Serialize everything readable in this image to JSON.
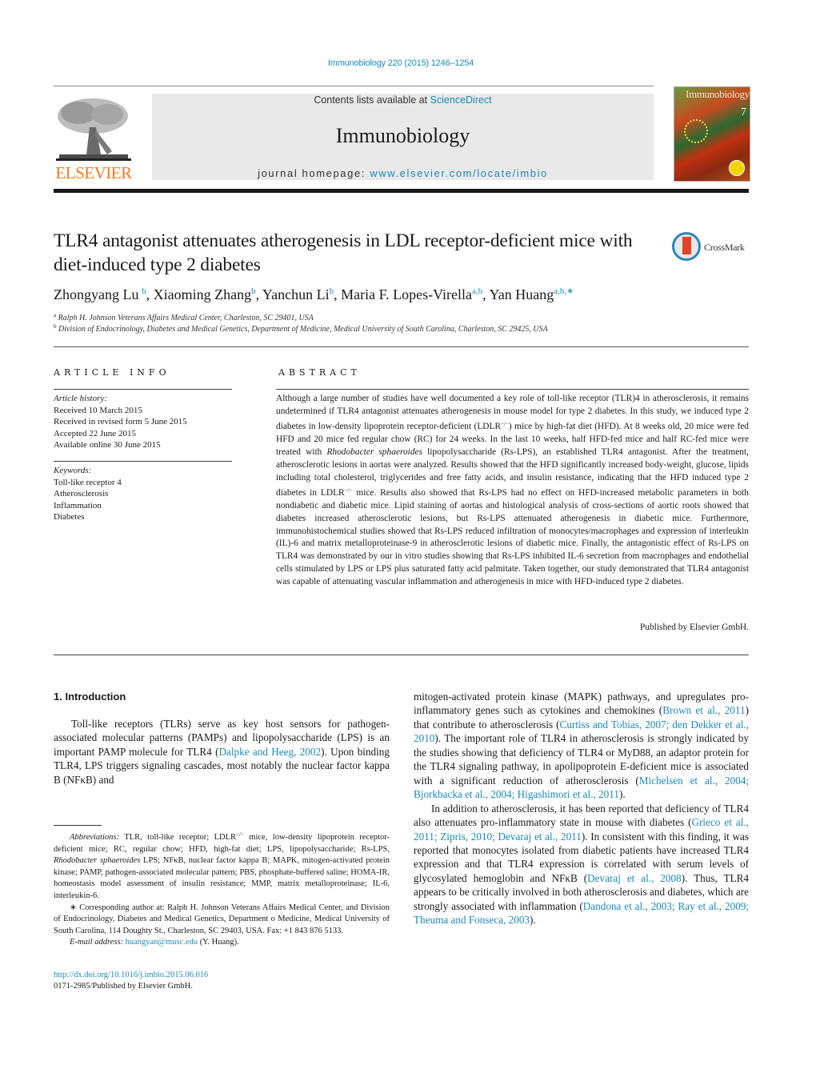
{
  "header": {
    "journal_ref": "Immunobiology 220 (2015) 1246–1254",
    "publisher_logo_text": "ELSEVIER",
    "contents_prefix": "Contents lists available at ",
    "contents_link": "ScienceDirect",
    "journal_title": "Immunobiology",
    "homepage_prefix": "journal homepage: ",
    "homepage_link": "www.elsevier.com/locate/imbio",
    "cover": {
      "title": "Immunobiology",
      "volume_number": "7"
    },
    "crossmark_label": "CrossMark"
  },
  "article": {
    "title": "TLR4 antagonist attenuates atherogenesis in LDL receptor-deficient mice with diet-induced type 2 diabetes",
    "authors": [
      {
        "name": "Zhongyang Lu",
        "sup": "b",
        "sep": ", "
      },
      {
        "name": "Xiaoming Zhang",
        "sup": "b",
        "sep": ", "
      },
      {
        "name": "Yanchun Li",
        "sup": "b",
        "sep": ", "
      },
      {
        "name": "Maria F. Lopes-Virella",
        "sup": "a,b",
        "sep": ", "
      },
      {
        "name": "Yan Huang",
        "sup": "a,b,∗",
        "sep": ""
      }
    ],
    "affiliations": [
      {
        "key": "a",
        "text": "Ralph H. Johnson Veterans Affairs Medical Center, Charleston, SC 29401, USA"
      },
      {
        "key": "b",
        "text": "Division of Endocrinology, Diabetes and Medical Genetics, Department of Medicine, Medical University of South Carolina, Charleston, SC 29425, USA"
      }
    ]
  },
  "article_info": {
    "heading": "ARTICLE INFO",
    "history_label": "Article history:",
    "history": [
      "Received 10 March 2015",
      "Received in revised form 5 June 2015",
      "Accepted 22 June 2015",
      "Available online 30 June 2015"
    ],
    "keywords_label": "Keywords:",
    "keywords": [
      "Toll-like receptor 4",
      "Atherosclerosis",
      "Inflammation",
      "Diabetes"
    ]
  },
  "abstract": {
    "heading": "ABSTRACT",
    "parts": {
      "p1": "Although a large number of studies have well documented a key role of toll-like receptor (TLR)4 in atherosclerosis, it remains undetermined if TLR4 antagonist attenuates atherogenesis in mouse model for type 2 diabetes. In this study, we induced type 2 diabetes in low-density lipoprotein receptor-deficient (LDLR",
      "ko": "−/−",
      "p2": ") mice by high-fat diet (HFD). At 8 weeks old, 20 mice were fed HFD and 20 mice fed regular chow (RC) for 24 weeks. In the last 10 weeks, half HFD-fed mice and half RC-fed mice were treated with ",
      "species": "Rhodobacter sphaeroides",
      "p3": " lipopolysaccharide (Rs-LPS), an established TLR4 antagonist. After the treatment, atherosclerotic lesions in aortas were analyzed. Results showed that the HFD significantly increased body-weight, glucose, lipids including total cholesterol, triglycerides and free fatty acids, and insulin resistance, indicating that the HFD induced type 2 diabetes in LDLR",
      "p4": " mice. Results also showed that Rs-LPS had no effect on HFD-increased metabolic parameters in both nondiabetic and diabetic mice. Lipid staining of aortas and histological analysis of cross-sections of aortic roots showed that diabetes increased atherosclerotic lesions, but Rs-LPS attenuated atherogenesis in diabetic mice. Furthermore, immunohistochemical studies showed that Rs-LPS reduced infiltration of monocytes/macrophages and expression of interleukin (IL)-6 and matrix metalloproteinase-9 in atherosclerotic lesions of diabetic mice. Finally, the antagonistic effect of Rs-LPS on TLR4 was demonstrated by our in vitro studies showing that Rs-LPS inhibited IL-6 secretion from macrophages and endothelial cells stimulated by LPS or LPS plus saturated fatty acid palmitate. Taken together, our study demonstrated that TLR4 antagonist was capable of attenuating vascular inflammation and atherogenesis in mice with HFD-induced type 2 diabetes."
    },
    "published_by": "Published by Elsevier GmbH."
  },
  "introduction": {
    "heading": "1.  Introduction",
    "left": {
      "t1": "Toll-like receptors (TLRs) serve as key host sensors for pathogen-associated molecular patterns (PAMPs) and lipopolysaccharide (LPS) is an important PAMP molecule for TLR4 (",
      "c1": "Dalpke and Heeg, 2002",
      "t2": "). Upon binding TLR4, LPS triggers signaling cascades, most notably the nuclear factor kappa B (NFκB) and"
    },
    "right_p1": {
      "t1": "mitogen-activated protein kinase (MAPK) pathways, and upregulates pro-inflammatory genes such as cytokines and chemokines (",
      "c1": "Brown et al., 2011",
      "t2": ") that contribute to atherosclerosis (",
      "c2": "Curtiss and Tobias, 2007; den Dekker et al., 2010",
      "t3": "). The important role of TLR4 in atherosclerosis is strongly indicated by the studies showing that deficiency of TLR4 or MyD88, an adaptor protein for the TLR4 signaling pathway, in apolipoprotein E-deficient mice is associated with a significant reduction of atherosclerosis (",
      "c3": "Michelsen et al., 2004; Bjorkbacka et al., 2004; Higashimori et al., 2011",
      "t4": ")."
    },
    "right_p2": {
      "t1": "In addition to atherosclerosis, it has been reported that deficiency of TLR4 also attenuates pro-inflammatory state in mouse with diabetes (",
      "c1": "Grieco et al., 2011; Zipris, 2010; Devaraj et al., 2011",
      "t2": "). In consistent with this finding, it was reported that monocytes isolated from diabetic patients have increased TLR4 expression and that TLR4 expression is correlated with serum levels of glycosylated hemoglobin and NFκB (",
      "c2": "Devaraj et al., 2008",
      "t3": "). Thus, TLR4 appears to be critically involved in both atherosclerosis and diabetes, which are strongly associated with inflammation (",
      "c3": "Dandona et al., 2003; Ray et al., 2009; Theuma and Fonseca, 2003",
      "t4": ")."
    }
  },
  "footnotes": {
    "abbrev_label": "Abbreviations:",
    "abbrev_1": " TLR, toll-like receptor; LDLR",
    "abbrev_ko": "−/−",
    "abbrev_2": " mice, low-density lipoprotein receptor-deficient mice; RC, regular chow; HFD, high-fat diet; LPS, lipopolysaccharide; Rs-LPS, ",
    "abbrev_species": "Rhodobacter sphaeroides",
    "abbrev_3": " LPS; NFκB, nuclear factor kappa B; MAPK, mitogen-activated protein kinase; PAMP, pathogen-associated molecular pattern; PBS, phosphate-buffered saline; HOMA-IR, homeostasis model assessment of insulin resistance; MMP, matrix metalloproteinase; IL-6, interleukin-6.",
    "corresponding": "∗ Corresponding author at: Ralph H. Johnson Veterans Affairs Medical Center, and Division of Endocrinology, Diabetes and Medical Genetics, Department o Medicine, Medical University of South Carolina, 114 Doughty St., Charleston, SC 29403, USA. Fax: +1 843 876 5133.",
    "email_label": "E-mail address:",
    "email": "huangyan@musc.edu",
    "email_suffix": " (Y. Huang)."
  },
  "doi": {
    "link": "http://dx.doi.org/10.1016/j.imbio.2015.06.016",
    "issn_line": "0171-2985/Published by Elsevier GmbH."
  },
  "colors": {
    "link": "#1a8ab8",
    "elsevier_orange": "#f47a20",
    "masthead_bg": "#e9e9e9"
  }
}
